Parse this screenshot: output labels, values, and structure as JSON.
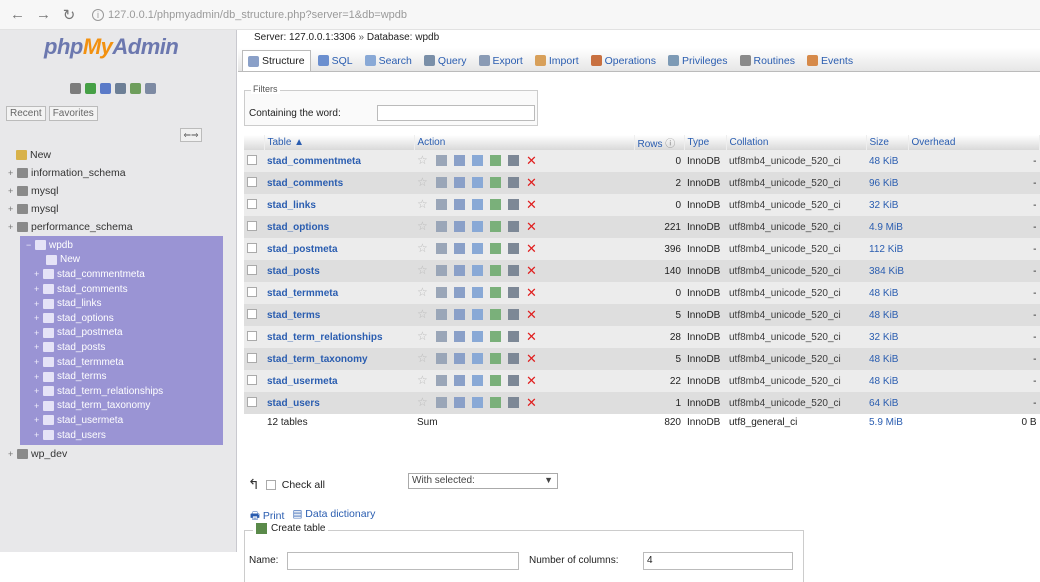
{
  "browser": {
    "url": "127.0.0.1/phpmyadmin/db_structure.php?server=1&db=wpdb"
  },
  "left": {
    "logo": {
      "php": "php",
      "my": "My",
      "admin": "Admin"
    },
    "recent_label": "Recent",
    "favorites_label": "Favorites",
    "tree": [
      {
        "label": "New",
        "type": "new"
      },
      {
        "label": "information_schema",
        "type": "db"
      },
      {
        "label": "mysql",
        "type": "db"
      },
      {
        "label": "mysql",
        "type": "db"
      },
      {
        "label": "performance_schema",
        "type": "db"
      }
    ],
    "wpdb": {
      "label": "wpdb",
      "items": [
        "New",
        "stad_commentmeta",
        "stad_comments",
        "stad_links",
        "stad_options",
        "stad_postmeta",
        "stad_posts",
        "stad_termmeta",
        "stad_terms",
        "stad_term_relationships",
        "stad_term_taxonomy",
        "stad_usermeta",
        "stad_users"
      ]
    },
    "after": [
      {
        "label": "wp_dev",
        "type": "db"
      }
    ]
  },
  "main": {
    "breadcrumb": {
      "server": "Server: 127.0.0.1:3306",
      "database": "Database: wpdb"
    },
    "tabs": [
      "Structure",
      "SQL",
      "Search",
      "Query",
      "Export",
      "Import",
      "Operations",
      "Privileges",
      "Routines",
      "Events"
    ],
    "filter": {
      "legend": "Filters",
      "label": "Containing the word:"
    },
    "table": {
      "headers": [
        "Table",
        "Action",
        "Rows",
        "Type",
        "Collation",
        "Size",
        "Overhead"
      ],
      "rows": [
        {
          "name": "stad_commentmeta",
          "rows": "0",
          "type": "InnoDB",
          "collation": "utf8mb4_unicode_520_ci",
          "size": "48 KiB",
          "overhead": "-"
        },
        {
          "name": "stad_comments",
          "rows": "2",
          "type": "InnoDB",
          "collation": "utf8mb4_unicode_520_ci",
          "size": "96 KiB",
          "overhead": "-"
        },
        {
          "name": "stad_links",
          "rows": "0",
          "type": "InnoDB",
          "collation": "utf8mb4_unicode_520_ci",
          "size": "32 KiB",
          "overhead": "-"
        },
        {
          "name": "stad_options",
          "rows": "221",
          "type": "InnoDB",
          "collation": "utf8mb4_unicode_520_ci",
          "size": "4.9 MiB",
          "overhead": "-"
        },
        {
          "name": "stad_postmeta",
          "rows": "396",
          "type": "InnoDB",
          "collation": "utf8mb4_unicode_520_ci",
          "size": "112 KiB",
          "overhead": "-"
        },
        {
          "name": "stad_posts",
          "rows": "140",
          "type": "InnoDB",
          "collation": "utf8mb4_unicode_520_ci",
          "size": "384 KiB",
          "overhead": "-"
        },
        {
          "name": "stad_termmeta",
          "rows": "0",
          "type": "InnoDB",
          "collation": "utf8mb4_unicode_520_ci",
          "size": "48 KiB",
          "overhead": "-"
        },
        {
          "name": "stad_terms",
          "rows": "5",
          "type": "InnoDB",
          "collation": "utf8mb4_unicode_520_ci",
          "size": "48 KiB",
          "overhead": "-"
        },
        {
          "name": "stad_term_relationships",
          "rows": "28",
          "type": "InnoDB",
          "collation": "utf8mb4_unicode_520_ci",
          "size": "32 KiB",
          "overhead": "-"
        },
        {
          "name": "stad_term_taxonomy",
          "rows": "5",
          "type": "InnoDB",
          "collation": "utf8mb4_unicode_520_ci",
          "size": "48 KiB",
          "overhead": "-"
        },
        {
          "name": "stad_usermeta",
          "rows": "22",
          "type": "InnoDB",
          "collation": "utf8mb4_unicode_520_ci",
          "size": "48 KiB",
          "overhead": "-"
        },
        {
          "name": "stad_users",
          "rows": "1",
          "type": "InnoDB",
          "collation": "utf8mb4_unicode_520_ci",
          "size": "64 KiB",
          "overhead": "-"
        }
      ],
      "summary": {
        "label": "12 tables",
        "sum": "Sum",
        "rows": "820",
        "type": "InnoDB",
        "collation": "utf8_general_ci",
        "size": "5.9 MiB",
        "overhead": "0 B"
      }
    },
    "check_all": "Check all",
    "with_selected": "With selected:",
    "print": "Print",
    "data_dictionary": "Data dictionary",
    "create": {
      "legend": "Create table",
      "name_label": "Name:",
      "cols_label": "Number of columns:",
      "cols_value": "4"
    }
  }
}
